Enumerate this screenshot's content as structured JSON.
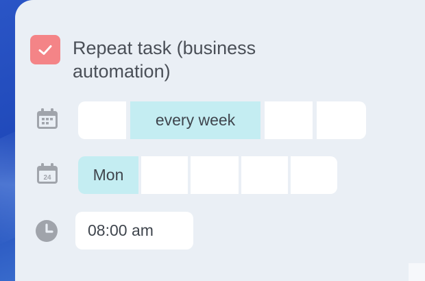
{
  "task": {
    "checked": true,
    "title": "Repeat task (business automation)"
  },
  "frequency": {
    "icon": "calendar-icon",
    "options": [
      "",
      "every week",
      "",
      ""
    ],
    "selected": "every week"
  },
  "weekday": {
    "icon": "calendar-date-icon",
    "icon_text": "24",
    "options": [
      "Mon",
      "",
      "",
      "",
      ""
    ],
    "selected": "Mon"
  },
  "time": {
    "icon": "clock-icon",
    "value": "08:00 am"
  },
  "colors": {
    "accent_checkbox": "#f48487",
    "selected_segment": "#c4edf2",
    "card_background": "#eaeff5",
    "page_background": "#2a55c6"
  }
}
